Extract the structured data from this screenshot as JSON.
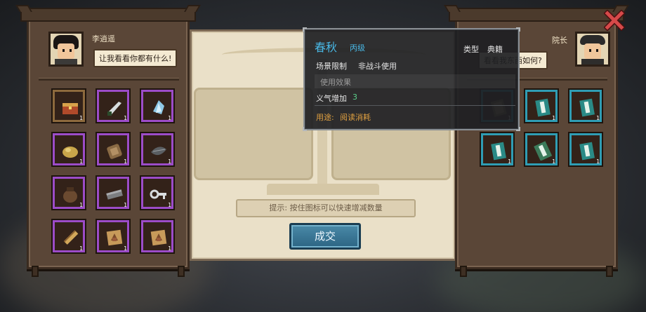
{
  "colors": {
    "rare_rim": "#9c4cc8",
    "fine_rim": "#2f9db4",
    "common_rim": "#8d6a3d",
    "tooltip_title": "#49b8e6",
    "tooltip_grade": "#49b8e6",
    "value_green": "#5bd08a",
    "usage_orange": "#e0a040",
    "deal_button": "#2c6483"
  },
  "left_panel": {
    "name": "李逍遥",
    "speech": "让我看看你都有什么!",
    "items": [
      {
        "icon": "treasure-chest-icon",
        "qty": "1",
        "rarity": "common"
      },
      {
        "icon": "dagger-icon",
        "qty": "1",
        "rarity": "rare"
      },
      {
        "icon": "crystal-icon",
        "qty": "1",
        "rarity": "rare"
      },
      {
        "icon": "ore-lump-icon",
        "qty": "1",
        "rarity": "rare"
      },
      {
        "icon": "scroll-case-icon",
        "qty": "1",
        "rarity": "rare"
      },
      {
        "icon": "leaf-blade-icon",
        "qty": "1",
        "rarity": "rare"
      },
      {
        "icon": "clay-jar-icon",
        "qty": "1",
        "rarity": "rare"
      },
      {
        "icon": "iron-bar-icon",
        "qty": "1",
        "rarity": "rare"
      },
      {
        "icon": "key-icon",
        "qty": "1",
        "rarity": "rare"
      },
      {
        "icon": "bamboo-scroll-icon",
        "qty": "1",
        "rarity": "rare"
      },
      {
        "icon": "map-scroll-icon",
        "qty": "1",
        "rarity": "rare"
      },
      {
        "icon": "map-scroll-icon",
        "qty": "1",
        "rarity": "rare"
      }
    ]
  },
  "right_panel": {
    "name": "院长",
    "speech": "看看我东西如何?",
    "items": [
      {
        "icon": "book-brown-icon",
        "qty": "1",
        "rarity": "fine"
      },
      {
        "icon": "book-teal-icon",
        "qty": "1",
        "rarity": "fine"
      },
      {
        "icon": "book-teal-icon",
        "qty": "1",
        "rarity": "fine"
      },
      {
        "icon": "book-teal-icon",
        "qty": "1",
        "rarity": "fine"
      },
      {
        "icon": "book-green-icon",
        "qty": "1",
        "rarity": "fine"
      },
      {
        "icon": "book-teal-icon",
        "qty": "1",
        "rarity": "fine"
      }
    ]
  },
  "trade": {
    "hint": "提示: 按住图标可以快速增减数量",
    "deal_label": "成交"
  },
  "tooltip": {
    "title": "春秋",
    "grade": "丙级",
    "type_label": "类型",
    "type_value": "典籍",
    "scene_label": "场景限制",
    "scene_value": "非战斗使用",
    "effect_header": "使用效果",
    "effect_label": "义气增加",
    "effect_value": "3",
    "usage_label": "用途:",
    "usage_value": "阅读消耗"
  }
}
